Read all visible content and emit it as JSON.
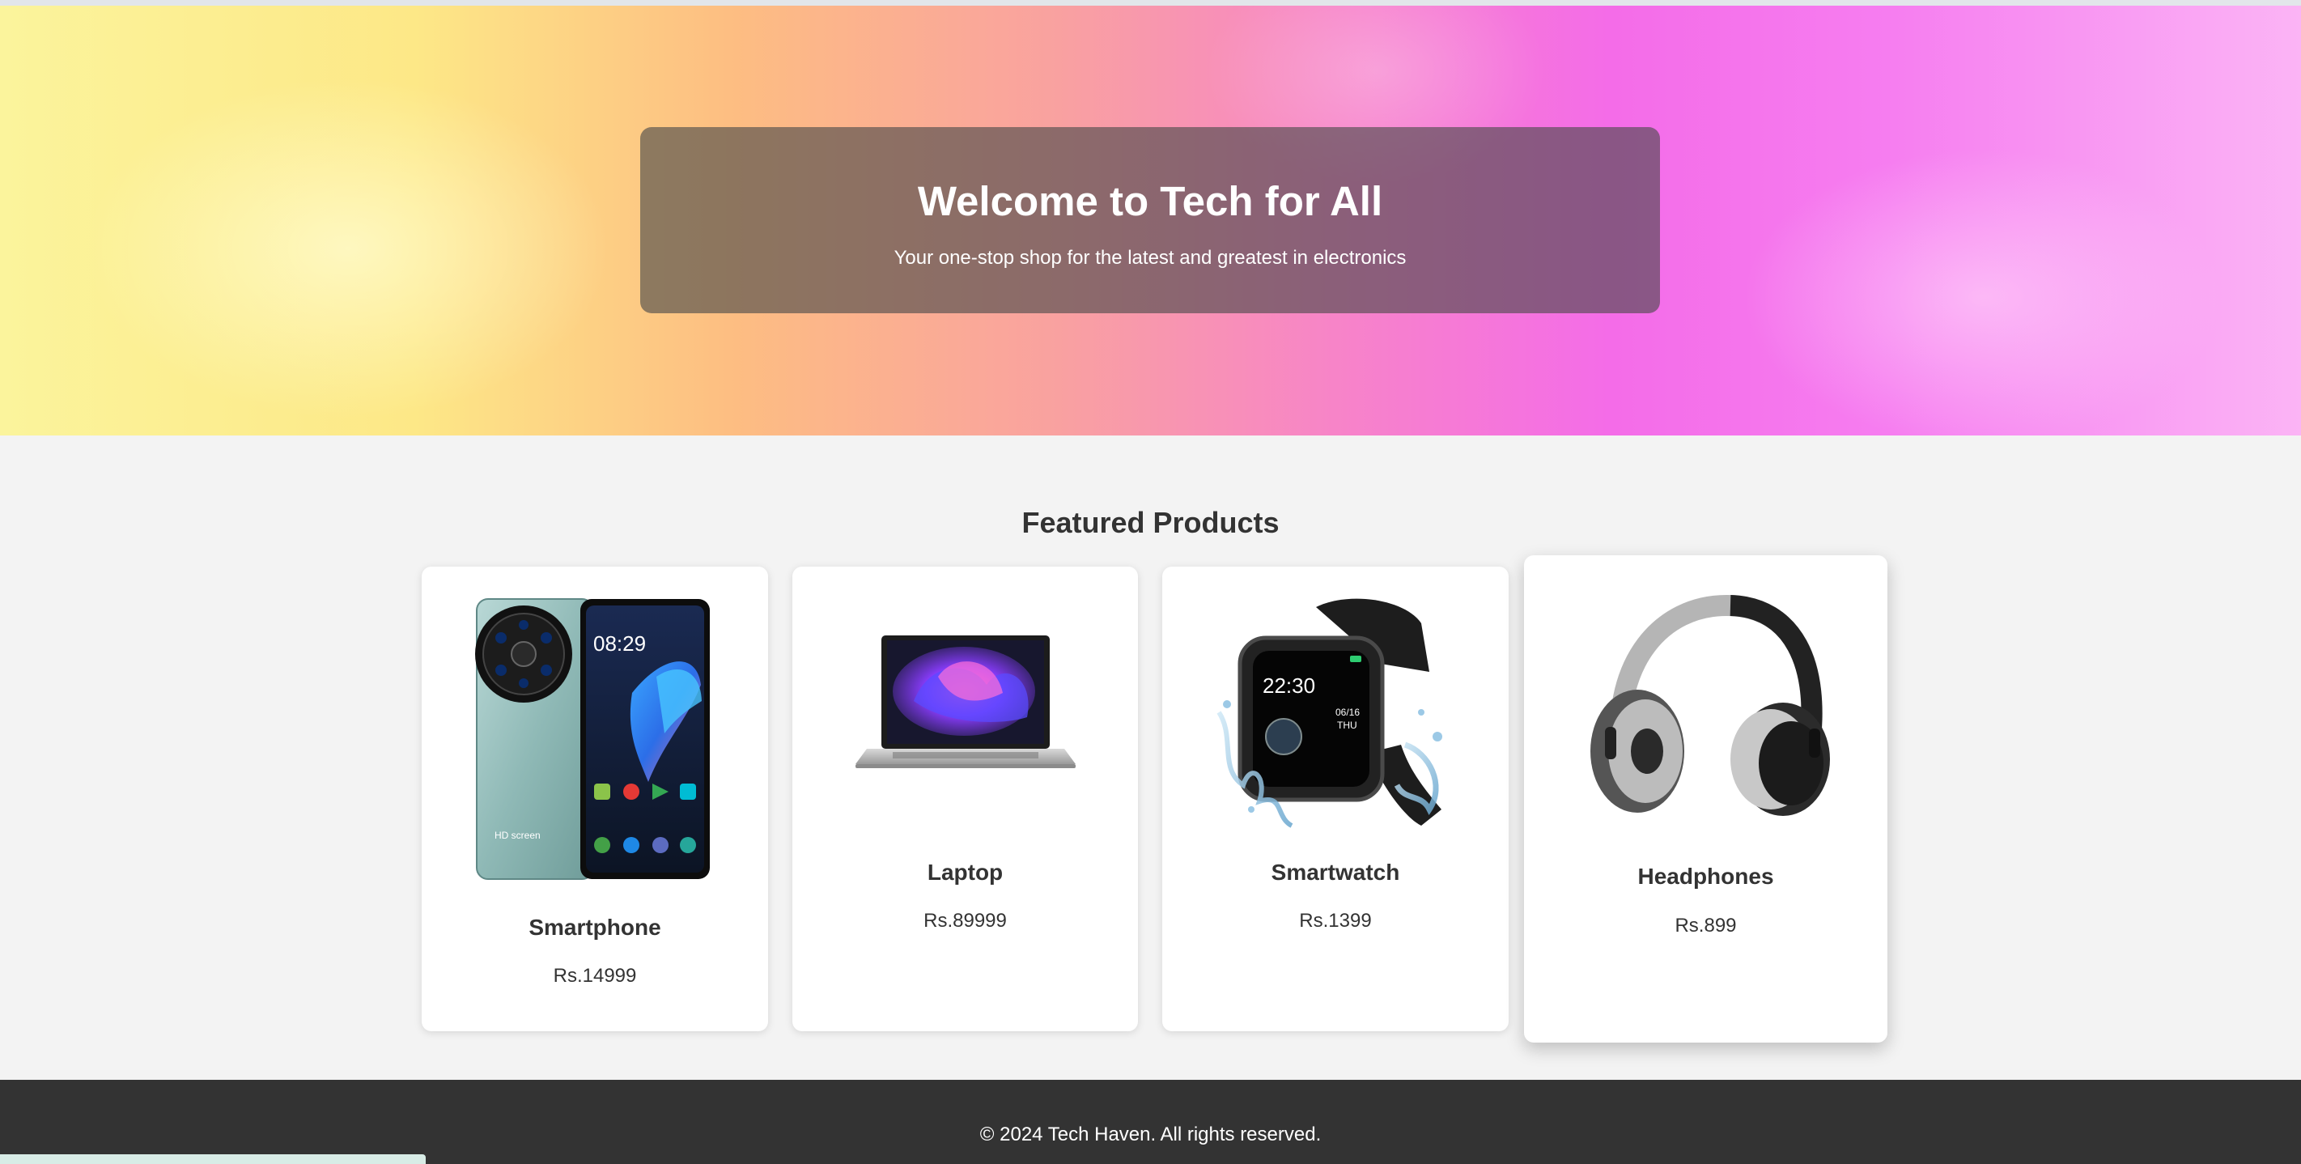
{
  "hero": {
    "title": "Welcome to Tech for All",
    "subtitle": "Your one-stop shop for the latest and greatest in electronics"
  },
  "featured": {
    "title": "Featured Products",
    "products": [
      {
        "name": "Smartphone",
        "price": "Rs.14999",
        "image_icon": "smartphone-image",
        "screen_label": "HD screen",
        "clock": "08:29"
      },
      {
        "name": "Laptop",
        "price": "Rs.89999",
        "image_icon": "laptop-image"
      },
      {
        "name": "Smartwatch",
        "price": "Rs.1399",
        "image_icon": "smartwatch-image",
        "clock": "22:30",
        "date_label": "06/16",
        "day_label": "THU"
      },
      {
        "name": "Headphones",
        "price": "Rs.899",
        "image_icon": "headphones-image"
      }
    ]
  },
  "footer": {
    "copyright": "© 2024 Tech Haven. All rights reserved."
  },
  "colors": {
    "footer_bg": "#333333",
    "page_bg": "#f3f3f3",
    "hero_card_bg": "rgba(72,72,72,0.62)"
  }
}
